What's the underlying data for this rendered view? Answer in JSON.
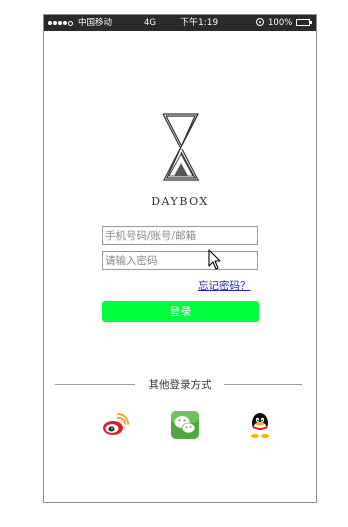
{
  "status_bar": {
    "carrier": "中国移动",
    "network": "4G",
    "time": "下午1:19",
    "battery": "100%",
    "icons": [
      "signal-dots-icon",
      "rotation-lock-icon",
      "battery-icon"
    ]
  },
  "brand": {
    "logo_icon": "hourglass-logo-icon",
    "name": "DAYBOX"
  },
  "form": {
    "account_placeholder": "手机号码/账号/邮箱",
    "password_placeholder": "请输入密码",
    "forgot_password": "忘记密码？",
    "login_button": "登录",
    "login_button_color": "#00ff3c",
    "link_color": "#1f1fb8"
  },
  "other_login": {
    "label": "其他登录方式",
    "providers": [
      {
        "name": "weibo",
        "icon": "weibo-icon"
      },
      {
        "name": "wechat",
        "icon": "wechat-icon"
      },
      {
        "name": "qq",
        "icon": "qq-icon"
      }
    ]
  }
}
